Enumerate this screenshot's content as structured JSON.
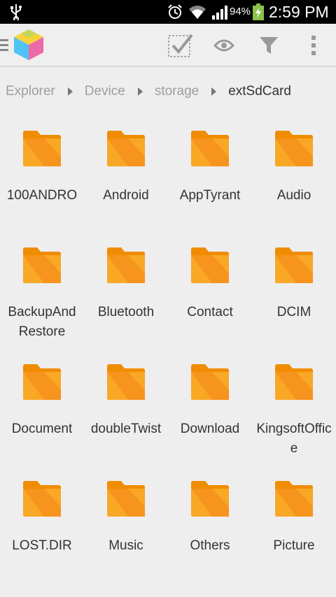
{
  "status_bar": {
    "battery_percent": "94%",
    "time": "2:59 PM",
    "icons": [
      "usb-icon",
      "alarm-icon",
      "wifi-icon",
      "signal-icon",
      "battery-charging-icon"
    ]
  },
  "action_bar": {
    "actions": [
      "select-icon",
      "view-icon",
      "filter-icon",
      "overflow-menu-icon"
    ]
  },
  "breadcrumb": [
    "Explorer",
    "Device",
    "storage",
    "extSdCard"
  ],
  "folders": [
    "100ANDRO",
    "Android",
    "AppTyrant",
    "Audio",
    "BackupAnd Restore",
    "Bluetooth",
    "Contact",
    "DCIM",
    "Document",
    "doubleTwist",
    "Download",
    "KingsoftOffice",
    "LOST.DIR",
    "Music",
    "Others",
    "Picture"
  ],
  "colors": {
    "folder": "#f9a825",
    "folder_dark": "#f08c00",
    "background": "#eeeeee"
  }
}
